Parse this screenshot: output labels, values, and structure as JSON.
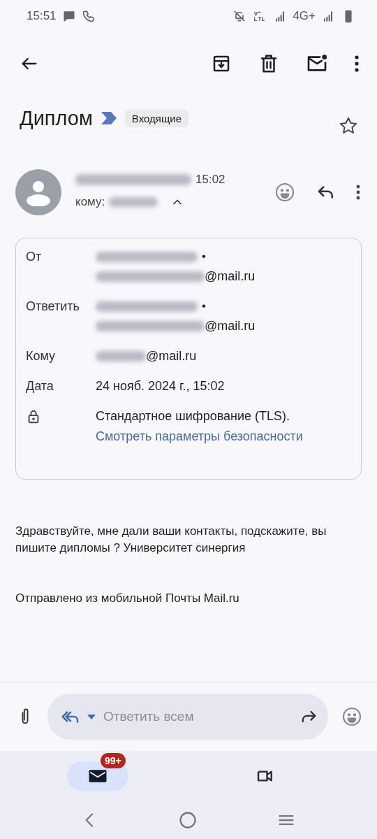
{
  "status_bar": {
    "time": "15:51",
    "network": "4G+"
  },
  "subject": {
    "title": "Диплом",
    "label": "Входящие",
    "starred": false
  },
  "sender": {
    "time": "15:02",
    "to_label": "кому:",
    "expanded": true
  },
  "details": [
    {
      "kind": "sender",
      "label": "От",
      "separator": "•",
      "domain": "@mail.ru"
    },
    {
      "kind": "sender",
      "label": "Ответить",
      "separator": "•",
      "domain": "@mail.ru"
    },
    {
      "kind": "recipient",
      "label": "Кому",
      "domain": "@mail.ru"
    },
    {
      "kind": "text",
      "label": "Дата",
      "value": "24 нояб. 2024 г., 15:02"
    },
    {
      "kind": "security",
      "value": "Стандартное шифрование (TLS).",
      "link": "Смотреть параметры безопасности"
    }
  ],
  "body": [
    "Здравствуйте, мне дали ваши контакты, подскажите, вы пишите дипломы ? Университет синергия",
    "Отправлено из мобильной Почты Mail.ru"
  ],
  "reply_bar": {
    "placeholder": "Ответить всем"
  },
  "bottom_nav": [
    {
      "kind": "mail",
      "selected": true,
      "badge": "99+"
    },
    {
      "kind": "video",
      "selected": false
    }
  ]
}
